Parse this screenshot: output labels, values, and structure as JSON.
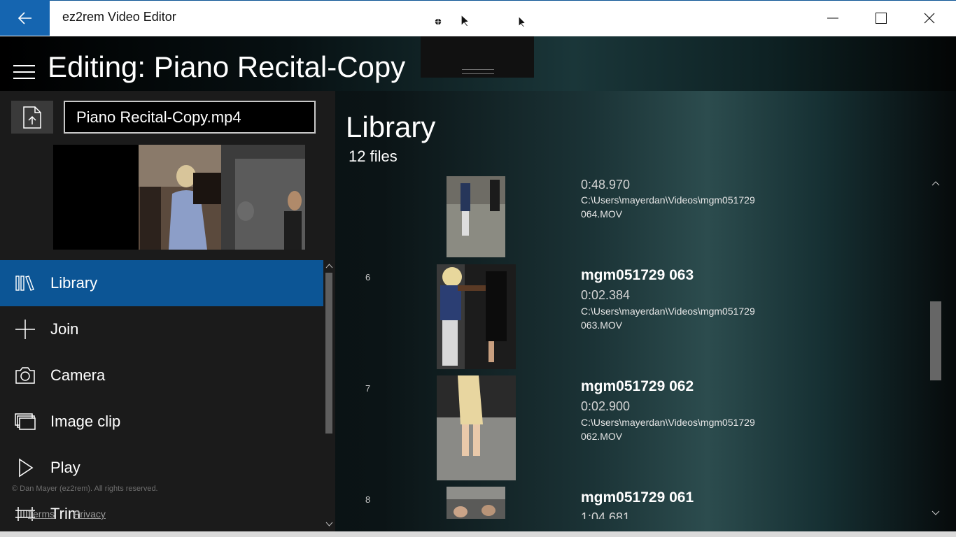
{
  "window": {
    "title": "ez2rem Video Editor",
    "back_icon": "arrow-left-icon",
    "controls": [
      "minimize-icon",
      "maximize-icon",
      "close-icon"
    ]
  },
  "header": {
    "title": "Editing: Piano Recital-Copy",
    "menu_icon": "hamburger-icon"
  },
  "toolbar": {
    "icons": [
      "select-region-icon",
      "select-pointer-icon",
      "fullscreen-frame-icon",
      "selection-pointer-icon"
    ]
  },
  "sidebar": {
    "export_icon": "file-upload-icon",
    "filename": "Piano Recital-Copy.mp4",
    "nav": [
      {
        "label": "Library",
        "icon": "library-icon",
        "selected": true
      },
      {
        "label": "Join",
        "icon": "plus-icon",
        "selected": false
      },
      {
        "label": "Camera",
        "icon": "camera-icon",
        "selected": false
      },
      {
        "label": "Image clip",
        "icon": "image-clip-icon",
        "selected": false
      },
      {
        "label": "Play",
        "icon": "play-icon",
        "selected": false
      },
      {
        "label": "Trim",
        "icon": "trim-icon",
        "selected": false
      }
    ],
    "copyright": "© Dan Mayer (ez2rem). All rights reserved.",
    "terms": "Terms",
    "privacy": "Privacy"
  },
  "library": {
    "title": "Library",
    "count": "12 files",
    "items": [
      {
        "index": "",
        "name": "",
        "duration": "0:48.970",
        "path": "C:\\Users\\mayerdan\\Videos\\mgm051729 064.MOV"
      },
      {
        "index": "6",
        "name": "mgm051729 063",
        "duration": "0:02.384",
        "path": "C:\\Users\\mayerdan\\Videos\\mgm051729 063.MOV"
      },
      {
        "index": "7",
        "name": "mgm051729 062",
        "duration": "0:02.900",
        "path": "C:\\Users\\mayerdan\\Videos\\mgm051729 062.MOV"
      },
      {
        "index": "8",
        "name": "mgm051729 061",
        "duration": "1:04.681",
        "path": ""
      }
    ]
  },
  "colors": {
    "accent": "#0c5595",
    "back_button": "#1565b0",
    "pane_bg": "#1b1b1b"
  }
}
